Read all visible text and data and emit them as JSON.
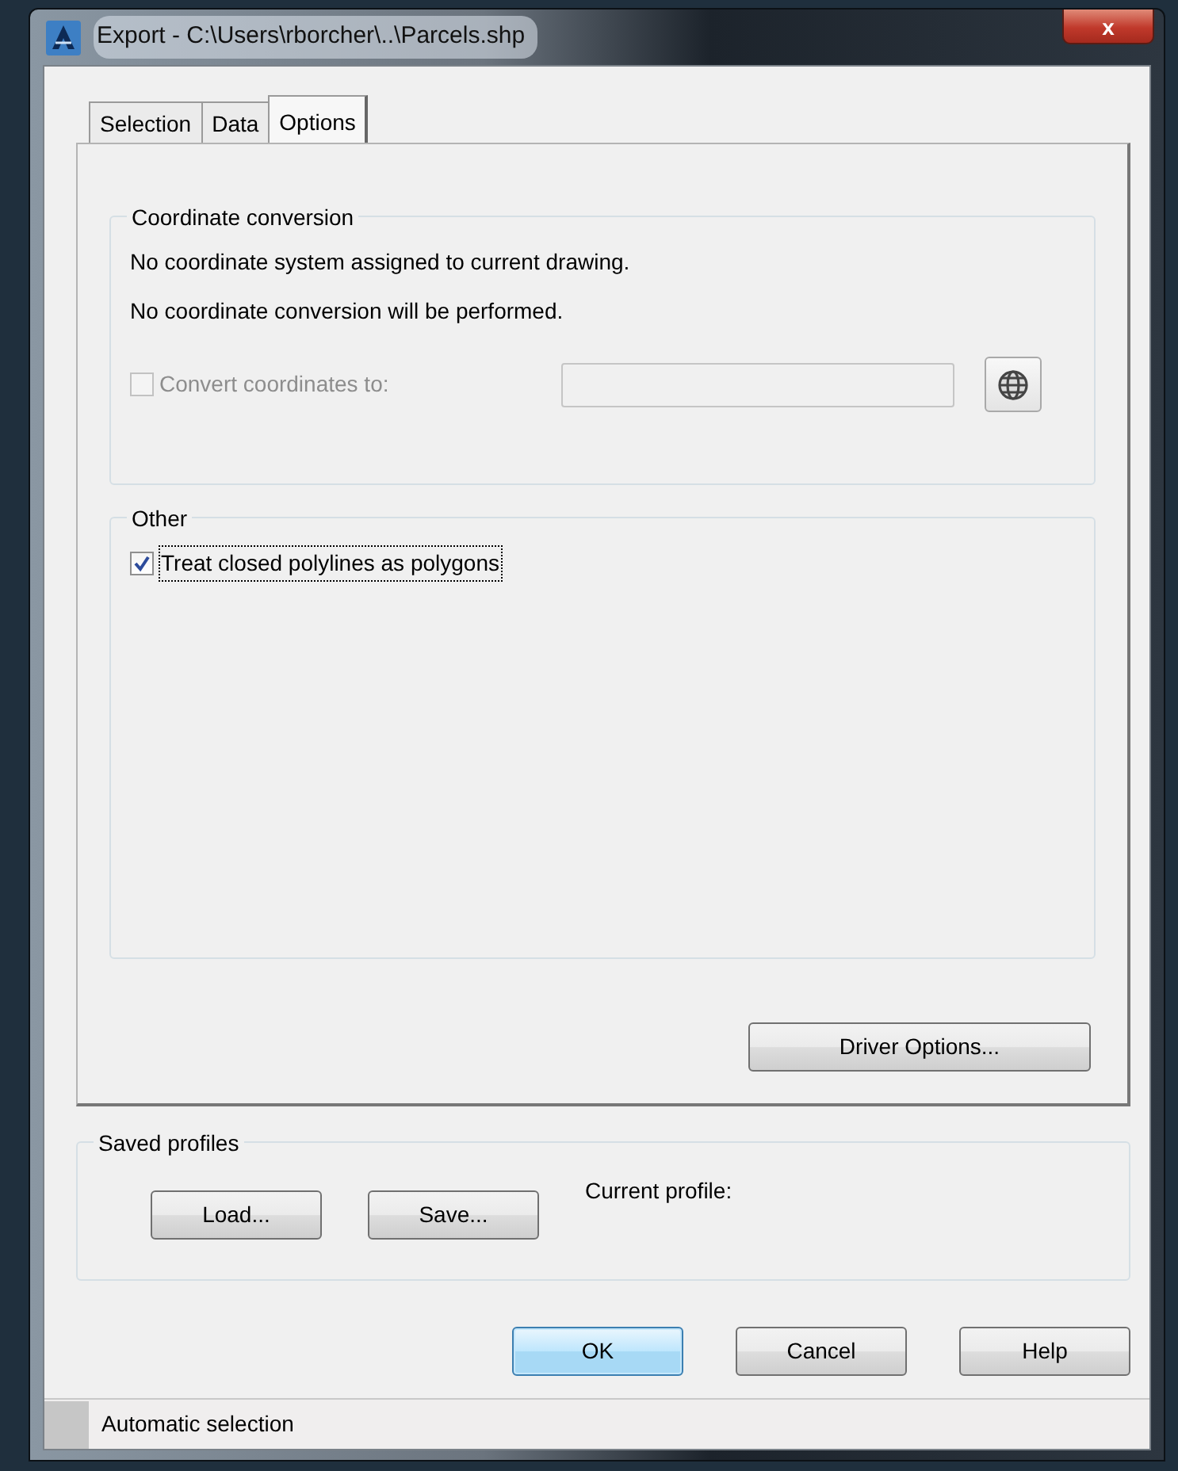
{
  "window": {
    "title": "Export - C:\\Users\\rborcher\\..\\Parcels.shp",
    "close": "x"
  },
  "tabs": [
    {
      "label": "Selection",
      "selected": false
    },
    {
      "label": "Data",
      "selected": false
    },
    {
      "label": "Options",
      "selected": true
    }
  ],
  "coordinate_conversion": {
    "title": "Coordinate conversion",
    "messages": [
      "No coordinate system assigned to current drawing.",
      "No coordinate conversion will be performed."
    ],
    "convert": {
      "label": "Convert coordinates to:",
      "checked": false,
      "disabled": true
    }
  },
  "other": {
    "title": "Other",
    "options": [
      {
        "label": "Treat closed polylines as polygons",
        "checked": true,
        "focused": true
      }
    ]
  },
  "driver_button": "Driver Options...",
  "saved_profiles": {
    "title": "Saved profiles",
    "buttons": [
      "Load...",
      "Save..."
    ],
    "current_profile_label": "Current profile:"
  },
  "buttons": [
    {
      "label": "OK",
      "default": true
    },
    {
      "label": "Cancel",
      "default": false
    },
    {
      "label": "Help",
      "default": false
    }
  ],
  "status_bar": "Automatic selection"
}
